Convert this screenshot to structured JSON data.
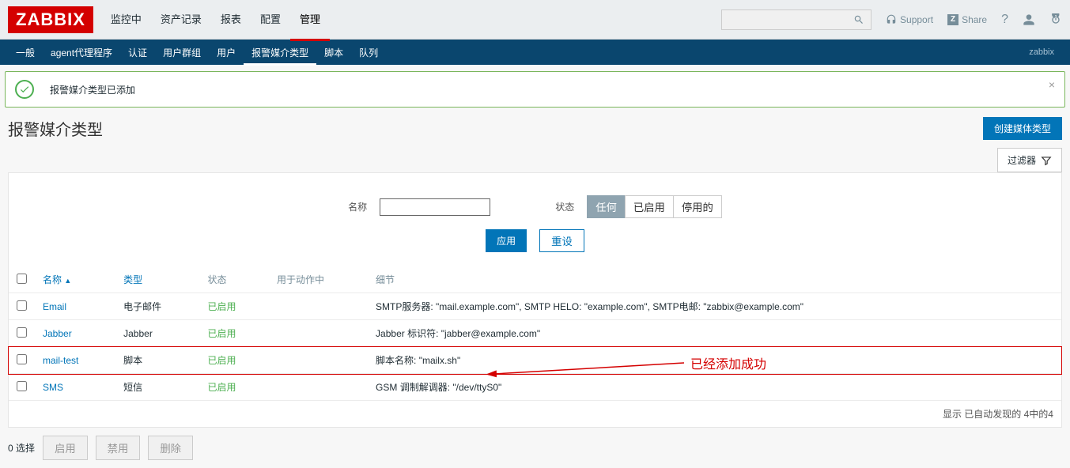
{
  "logo": "ZABBIX",
  "topnav": [
    "监控中",
    "资产记录",
    "报表",
    "配置",
    "管理"
  ],
  "topnav_active": 4,
  "toptools": {
    "support": "Support",
    "share": "Share"
  },
  "subnav": [
    "一般",
    "agent代理程序",
    "认证",
    "用户群组",
    "用户",
    "报警媒介类型",
    "脚本",
    "队列"
  ],
  "subnav_active": 5,
  "subuser": "zabbix",
  "alert": {
    "message": "报警媒介类型已添加"
  },
  "page": {
    "title": "报警媒介类型",
    "create_btn": "创建媒体类型",
    "filter_label": "过滤器"
  },
  "filter": {
    "name_label": "名称",
    "status_label": "状态",
    "status_options": [
      "任何",
      "已启用",
      "停用的"
    ],
    "status_selected": 0,
    "apply": "应用",
    "reset": "重设"
  },
  "columns": {
    "name": "名称",
    "type": "类型",
    "status": "状态",
    "used_in": "用于动作中",
    "details": "细节"
  },
  "rows": [
    {
      "name": "Email",
      "type": "电子邮件",
      "status": "已启用",
      "details": "SMTP服务器: \"mail.example.com\", SMTP HELO: \"example.com\", SMTP电邮: \"zabbix@example.com\"",
      "hl": false
    },
    {
      "name": "Jabber",
      "type": "Jabber",
      "status": "已启用",
      "details": "Jabber 标识符: \"jabber@example.com\"",
      "hl": false
    },
    {
      "name": "mail-test",
      "type": "脚本",
      "status": "已启用",
      "details": "脚本名称: \"mailx.sh\"",
      "hl": true
    },
    {
      "name": "SMS",
      "type": "短信",
      "status": "已启用",
      "details": "GSM 调制解调器: \"/dev/ttyS0\"",
      "hl": false
    }
  ],
  "footer": "显示 已自动发现的 4中的4",
  "bulk": {
    "selected": "0 选择",
    "enable": "启用",
    "disable": "禁用",
    "delete": "删除"
  },
  "annotation": "已经添加成功"
}
